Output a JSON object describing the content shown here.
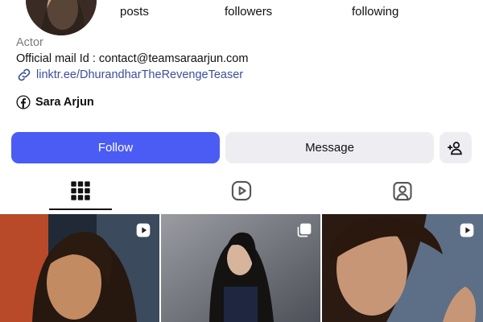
{
  "stats": {
    "posts_label": "posts",
    "followers_label": "followers",
    "following_label": "following"
  },
  "bio": {
    "category": "Actor",
    "line1": "Official mail Id : contact@teamsaraarjun.com",
    "link": "linktr.ee/DhurandharTheRevengeTeaser",
    "link_icon": "link-icon",
    "facebook_name": "Sara Arjun",
    "facebook_icon": "facebook-icon"
  },
  "actions": {
    "follow_label": "Follow",
    "message_label": "Message",
    "add_user_icon": "add-user-icon",
    "follow_color": "#4a5cf4"
  },
  "tabs": [
    {
      "name": "grid",
      "icon": "grid-icon",
      "active": true
    },
    {
      "name": "reels",
      "icon": "reels-icon",
      "active": false
    },
    {
      "name": "tagged",
      "icon": "tagged-icon",
      "active": false
    }
  ],
  "posts": [
    {
      "badge_icon": "reel-badge-icon"
    },
    {
      "badge_icon": "carousel-badge-icon"
    },
    {
      "badge_icon": "reel-badge-icon"
    }
  ]
}
